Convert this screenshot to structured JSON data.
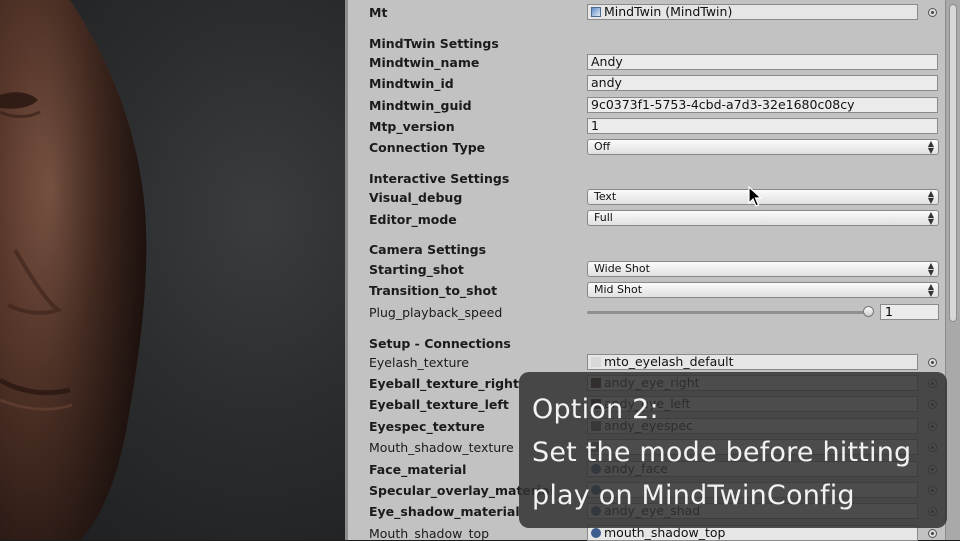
{
  "inspector": {
    "mt": {
      "label": "Mt",
      "value": "MindTwin (MindTwin)"
    },
    "sections": {
      "mindtwin": "MindTwin Settings",
      "interactive": "Interactive Settings",
      "camera": "Camera Settings",
      "setup": "Setup - Connections"
    },
    "fields": {
      "name": {
        "label": "Mindtwin_name",
        "value": "Andy"
      },
      "id": {
        "label": "Mindtwin_id",
        "value": "andy"
      },
      "guid": {
        "label": "Mindtwin_guid",
        "value": "9c0373f1-5753-4cbd-a7d3-32e1680c08cy"
      },
      "mtp": {
        "label": "Mtp_version",
        "value": "1"
      },
      "connection": {
        "label": "Connection Type",
        "value": "Off"
      },
      "visual_debug": {
        "label": "Visual_debug",
        "value": "Text"
      },
      "editor_mode": {
        "label": "Editor_mode",
        "value": "Full"
      },
      "starting_shot": {
        "label": "Starting_shot",
        "value": "Wide Shot"
      },
      "transition_shot": {
        "label": "Transition_to_shot",
        "value": "Mid Shot"
      },
      "plug_speed": {
        "label": "Plug_playback_speed",
        "value": "1",
        "fraction": 1.0
      }
    },
    "connections": [
      {
        "label": "Eyelash_texture",
        "value": "mto_eyelash_default",
        "bold": false
      },
      {
        "label": "Eyeball_texture_right",
        "value": "andy_eye_right",
        "bold": true
      },
      {
        "label": "Eyeball_texture_left",
        "value": "andy_eye_left",
        "bold": true
      },
      {
        "label": "Eyespec_texture",
        "value": "andy_eyespec",
        "bold": true
      },
      {
        "label": "Mouth_shadow_texture",
        "value": "",
        "bold": false
      },
      {
        "label": "Face_material",
        "value": "andy_face",
        "bold": true
      },
      {
        "label": "Specular_overlay_material",
        "value": "",
        "bold": true
      },
      {
        "label": "Eye_shadow_material",
        "value": "andy_eye_shad",
        "bold": true
      },
      {
        "label": "Mouth_shadow_top",
        "value": "mouth_shadow_top",
        "bold": false
      }
    ]
  },
  "caption": {
    "line1": "Option 2:",
    "line2": "Set the mode before hitting",
    "line3": "play on MindTwinConfig"
  },
  "colors": {
    "panel_bg": "#c2c2c2",
    "caption_bg": "#323232"
  }
}
